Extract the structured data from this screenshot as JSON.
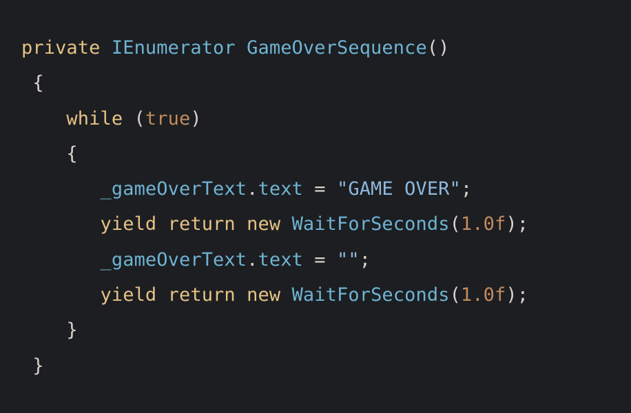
{
  "editor": {
    "lines": [
      [
        {
          "t": "private",
          "c": "kw"
        },
        {
          "t": " ",
          "c": "punc"
        },
        {
          "t": "IEnumerator",
          "c": "ty"
        },
        {
          "t": " ",
          "c": "punc"
        },
        {
          "t": "GameOverSequence",
          "c": "ty"
        },
        {
          "t": "()",
          "c": "punc"
        }
      ],
      [
        {
          "t": " {",
          "c": "punc"
        }
      ],
      [
        {
          "t": "    ",
          "c": "punc"
        },
        {
          "t": "while",
          "c": "kw"
        },
        {
          "t": " (",
          "c": "punc"
        },
        {
          "t": "true",
          "c": "num"
        },
        {
          "t": ")",
          "c": "punc"
        }
      ],
      [
        {
          "t": "    {",
          "c": "punc"
        }
      ],
      [
        {
          "t": "       ",
          "c": "punc"
        },
        {
          "t": "_gameOverText",
          "c": "ty"
        },
        {
          "t": ".",
          "c": "punc"
        },
        {
          "t": "text",
          "c": "ty"
        },
        {
          "t": " = ",
          "c": "punc"
        },
        {
          "t": "\"GAME OVER\"",
          "c": "str"
        },
        {
          "t": ";",
          "c": "punc"
        }
      ],
      [
        {
          "t": "       ",
          "c": "punc"
        },
        {
          "t": "yield",
          "c": "kw"
        },
        {
          "t": " ",
          "c": "punc"
        },
        {
          "t": "return",
          "c": "kw"
        },
        {
          "t": " ",
          "c": "punc"
        },
        {
          "t": "new",
          "c": "kw"
        },
        {
          "t": " ",
          "c": "punc"
        },
        {
          "t": "WaitForSeconds",
          "c": "ty"
        },
        {
          "t": "(",
          "c": "punc"
        },
        {
          "t": "1.0f",
          "c": "num"
        },
        {
          "t": ");",
          "c": "punc"
        }
      ],
      [
        {
          "t": "       ",
          "c": "punc"
        },
        {
          "t": "_gameOverText",
          "c": "ty"
        },
        {
          "t": ".",
          "c": "punc"
        },
        {
          "t": "text",
          "c": "ty"
        },
        {
          "t": " = ",
          "c": "punc"
        },
        {
          "t": "\"\"",
          "c": "str"
        },
        {
          "t": ";",
          "c": "punc"
        }
      ],
      [
        {
          "t": "       ",
          "c": "punc"
        },
        {
          "t": "yield",
          "c": "kw"
        },
        {
          "t": " ",
          "c": "punc"
        },
        {
          "t": "return",
          "c": "kw"
        },
        {
          "t": " ",
          "c": "punc"
        },
        {
          "t": "new",
          "c": "kw"
        },
        {
          "t": " ",
          "c": "punc"
        },
        {
          "t": "WaitForSeconds",
          "c": "ty"
        },
        {
          "t": "(",
          "c": "punc"
        },
        {
          "t": "1.0f",
          "c": "num"
        },
        {
          "t": ");",
          "c": "punc"
        }
      ],
      [
        {
          "t": "    }",
          "c": "punc"
        }
      ],
      [
        {
          "t": " }",
          "c": "punc"
        }
      ]
    ]
  },
  "colors": {
    "background": "#1c1e22",
    "keyword": "#e6c383",
    "type": "#6fb3d2",
    "number": "#c58b5c",
    "string": "#8fb8dd",
    "punctuation": "#d8d4cb"
  }
}
